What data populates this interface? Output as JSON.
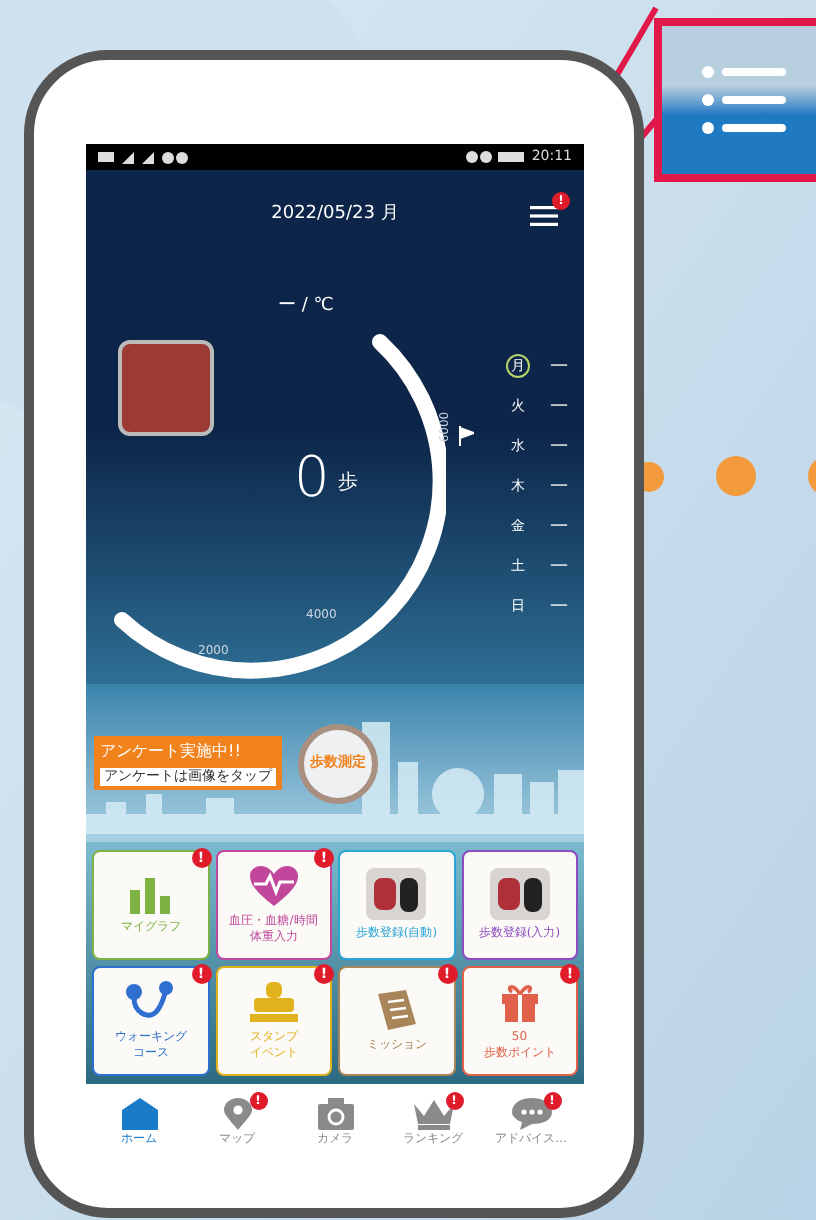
{
  "status_bar": {
    "time": "20:11"
  },
  "header": {
    "date": "2022/05/23 月",
    "menu_badge": "!"
  },
  "weather": {
    "temperature": "ー / ℃"
  },
  "steps": {
    "count": "0",
    "unit": "歩",
    "ticks": [
      "2000",
      "4000",
      "6000"
    ]
  },
  "week": [
    {
      "day": "月",
      "value": "—",
      "selected": true
    },
    {
      "day": "火",
      "value": "—",
      "selected": false
    },
    {
      "day": "水",
      "value": "—",
      "selected": false
    },
    {
      "day": "木",
      "value": "—",
      "selected": false
    },
    {
      "day": "金",
      "value": "—",
      "selected": false
    },
    {
      "day": "土",
      "value": "—",
      "selected": false
    },
    {
      "day": "日",
      "value": "—",
      "selected": false
    }
  ],
  "banner": {
    "title": "アンケート実施中!!",
    "subtitle": "アンケートは画像をタップ",
    "measure_button": "歩数測定"
  },
  "tiles": [
    {
      "lines": [
        "マイグラフ"
      ],
      "kind": "chart",
      "color": "#7cb342",
      "badge": "!"
    },
    {
      "lines": [
        "血圧・血糖/時間",
        "体重入力"
      ],
      "kind": "heart",
      "color": "#c0479b",
      "badge": "!"
    },
    {
      "lines": [
        "歩数登録(自動)"
      ],
      "kind": "photo",
      "color": "#2aa5d6"
    },
    {
      "lines": [
        "歩数登録(入力)"
      ],
      "kind": "photo",
      "color": "#8e4cc0"
    },
    {
      "lines": [
        "ウォーキング",
        "コース"
      ],
      "kind": "route",
      "color": "#2f6fd0",
      "badge": "!"
    },
    {
      "lines": [
        "スタンプ",
        "イベント"
      ],
      "kind": "stamp",
      "color": "#e0b21e",
      "badge": "!"
    },
    {
      "lines": [
        "ミッション"
      ],
      "kind": "scroll",
      "color": "#a9865a",
      "badge": "!"
    },
    {
      "lines": [
        "50",
        "歩数ポイント"
      ],
      "kind": "gift",
      "color": "#e0604a",
      "badge": "!"
    }
  ],
  "nav": [
    {
      "label": "ホーム",
      "kind": "home",
      "selected": true
    },
    {
      "label": "マップ",
      "kind": "pin",
      "selected": false,
      "badge": "!"
    },
    {
      "label": "カメラ",
      "kind": "camera",
      "selected": false
    },
    {
      "label": "ランキング",
      "kind": "crown",
      "selected": false,
      "badge": "!"
    },
    {
      "label": "アドバイス...",
      "kind": "chat",
      "selected": false,
      "badge": "!"
    }
  ]
}
